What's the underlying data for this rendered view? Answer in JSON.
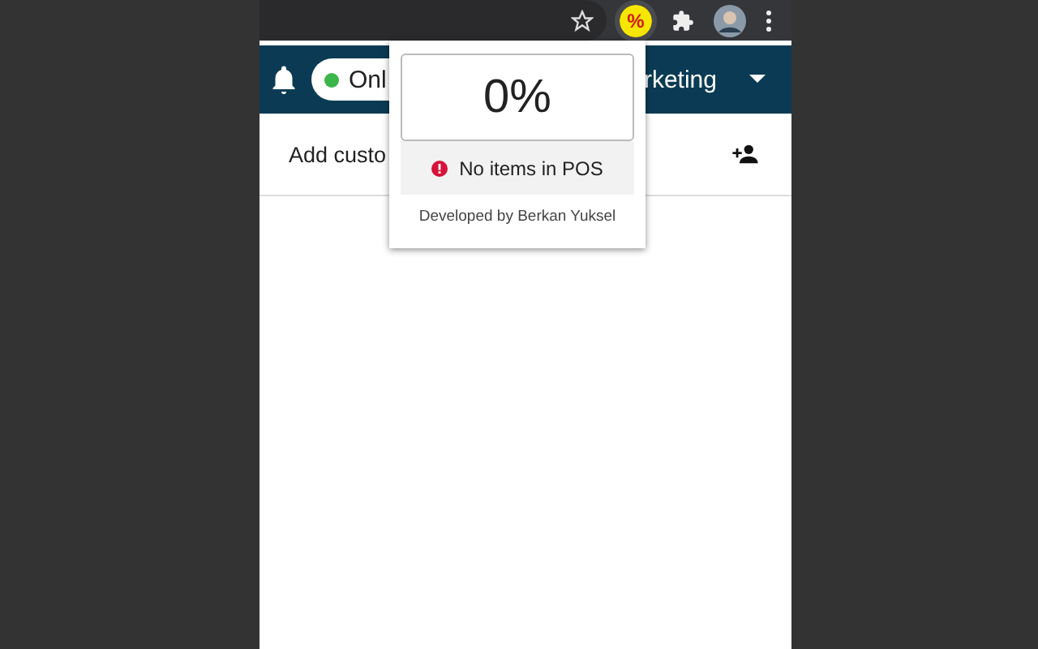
{
  "browser_toolbar": {
    "extension_label": "%"
  },
  "header": {
    "status": {
      "label": "Onl",
      "online": true
    },
    "account": "rketing"
  },
  "customer_row": {
    "label": "Add custo"
  },
  "popup": {
    "percentage": "0%",
    "message": "No items in POS",
    "footer": "Developed by Berkan Yuksel"
  }
}
